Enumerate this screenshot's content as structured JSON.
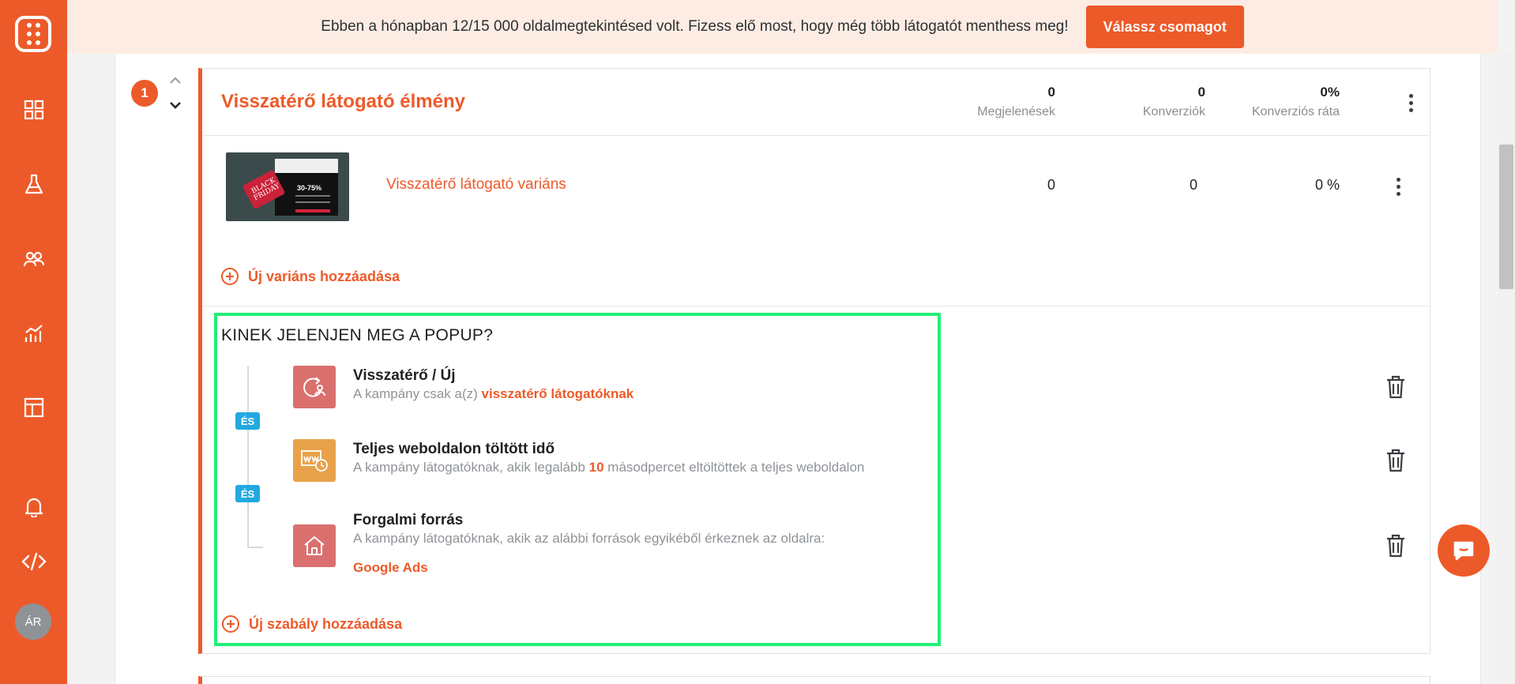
{
  "sidebar": {
    "items": [
      "dashboard",
      "experiments",
      "audience",
      "analytics",
      "templates"
    ],
    "avatar_initials": "ÁR"
  },
  "banner": {
    "text": "Ebben a hónapban 12/15 000 oldalmegtekintésed volt. Fizess elő most, hogy még több látogatót menthess meg!",
    "cta": "Válassz csomagot"
  },
  "campaign": {
    "index": "1",
    "title": "Visszatérő látogató élmény",
    "stats": [
      {
        "value": "0",
        "label": "Megjelenések"
      },
      {
        "value": "0",
        "label": "Konverziók"
      },
      {
        "value": "0%",
        "label": "Konverziós ráta"
      }
    ],
    "variant": {
      "name": "Visszatérő látogató variáns",
      "thumb_tag": "BLACK FRIDAY",
      "thumb_pct": "30-75%",
      "impressions": "0",
      "conversions": "0",
      "rate": "0 %"
    },
    "add_variant": "Új variáns hozzáadása"
  },
  "rules": {
    "title": "KINEK JELENJEN MEG A POPUP?",
    "connector": "ÉS",
    "items": [
      {
        "title": "Visszatérő / Új",
        "desc_prefix": "A kampány csak a(z) ",
        "desc_highlight": "visszatérő látogatóknak",
        "desc_suffix": "",
        "icon": "returning-visitor-icon",
        "color": "#d9706e"
      },
      {
        "title": "Teljes weboldalon töltött idő",
        "desc_prefix": "A kampány látogatóknak, akik legalább ",
        "desc_highlight": "10",
        "desc_suffix": " másodpercet eltöltöttek a teljes weboldalon",
        "icon": "time-on-site-icon",
        "color": "#e8a24a"
      },
      {
        "title": "Forgalmi forrás",
        "desc_prefix": "A kampány látogatóknak, akik az alábbi források egyikéből érkeznek az oldalra:",
        "desc_highlight": "",
        "desc_suffix": "",
        "extra": "Google Ads",
        "icon": "home-icon",
        "color": "#d9706e"
      }
    ],
    "add_rule": "Új szabály hozzáadása"
  },
  "colors": {
    "brand": "#ed5a29",
    "highlight_box": "#22ee77",
    "connector": "#21a9e0"
  }
}
